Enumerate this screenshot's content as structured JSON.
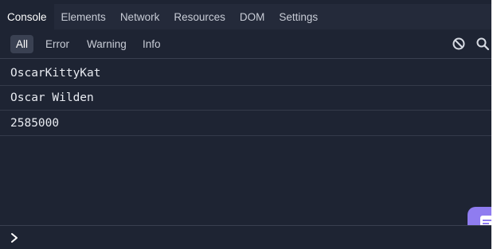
{
  "tabs": [
    {
      "label": "Console",
      "active": true
    },
    {
      "label": "Elements"
    },
    {
      "label": "Network"
    },
    {
      "label": "Resources"
    },
    {
      "label": "DOM"
    },
    {
      "label": "Settings"
    }
  ],
  "filters": [
    {
      "label": "All",
      "active": true
    },
    {
      "label": "Error"
    },
    {
      "label": "Warning"
    },
    {
      "label": "Info"
    }
  ],
  "toolbar_icons": [
    "clear-icon",
    "search-icon"
  ],
  "logs": [
    "OscarKittyKat",
    "Oscar Wilden",
    "2585000"
  ],
  "prompt": {
    "icon": "chevron-right-icon",
    "value": ""
  },
  "colors": {
    "panel_bg": "#1e2433",
    "tabbar_bg": "#242a3a",
    "active_filter_bg": "#3a4152",
    "chat_button": "#8f7cf0"
  }
}
